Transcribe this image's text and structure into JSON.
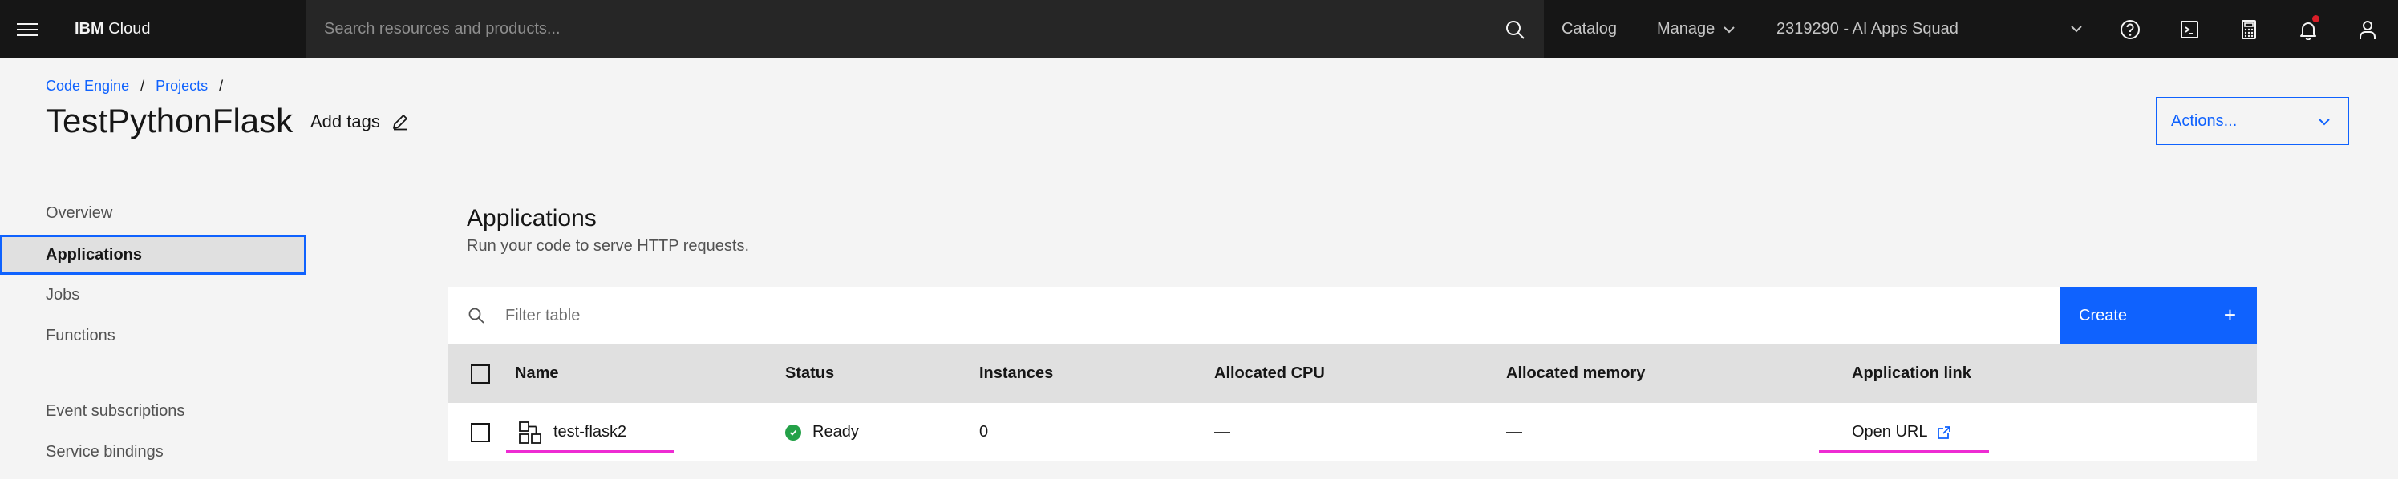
{
  "header": {
    "brand_prefix": "IBM",
    "brand_suffix": "Cloud",
    "search_placeholder": "Search resources and products...",
    "catalog_label": "Catalog",
    "manage_label": "Manage",
    "account_label": "2319290 - AI Apps Squad"
  },
  "breadcrumb": {
    "items": [
      "Code Engine",
      "Projects"
    ],
    "separator": "/"
  },
  "page": {
    "title": "TestPythonFlask",
    "add_tags_label": "Add tags",
    "actions_label": "Actions..."
  },
  "sidebar": {
    "items": [
      {
        "label": "Overview",
        "active": false
      },
      {
        "label": "Applications",
        "active": true
      },
      {
        "label": "Jobs",
        "active": false
      },
      {
        "label": "Functions",
        "active": false
      },
      {
        "label": "Event subscriptions",
        "active": false
      },
      {
        "label": "Service bindings",
        "active": false
      }
    ]
  },
  "main": {
    "section_title": "Applications",
    "section_desc": "Run your code to serve HTTP requests.",
    "filter_placeholder": "Filter table",
    "create_label": "Create",
    "create_icon": "+",
    "columns": [
      "Name",
      "Status",
      "Instances",
      "Allocated CPU",
      "Allocated memory",
      "Application link"
    ],
    "rows": [
      {
        "name": "test-flask2",
        "status": "Ready",
        "instances": "0",
        "cpu": "—",
        "memory": "—",
        "link": "Open URL"
      }
    ]
  },
  "colors": {
    "accent": "#0f62fe",
    "header_bg": "#161616",
    "status_ready": "#24a148",
    "highlight": "#ee2bd3",
    "notification": "#da1e28"
  }
}
